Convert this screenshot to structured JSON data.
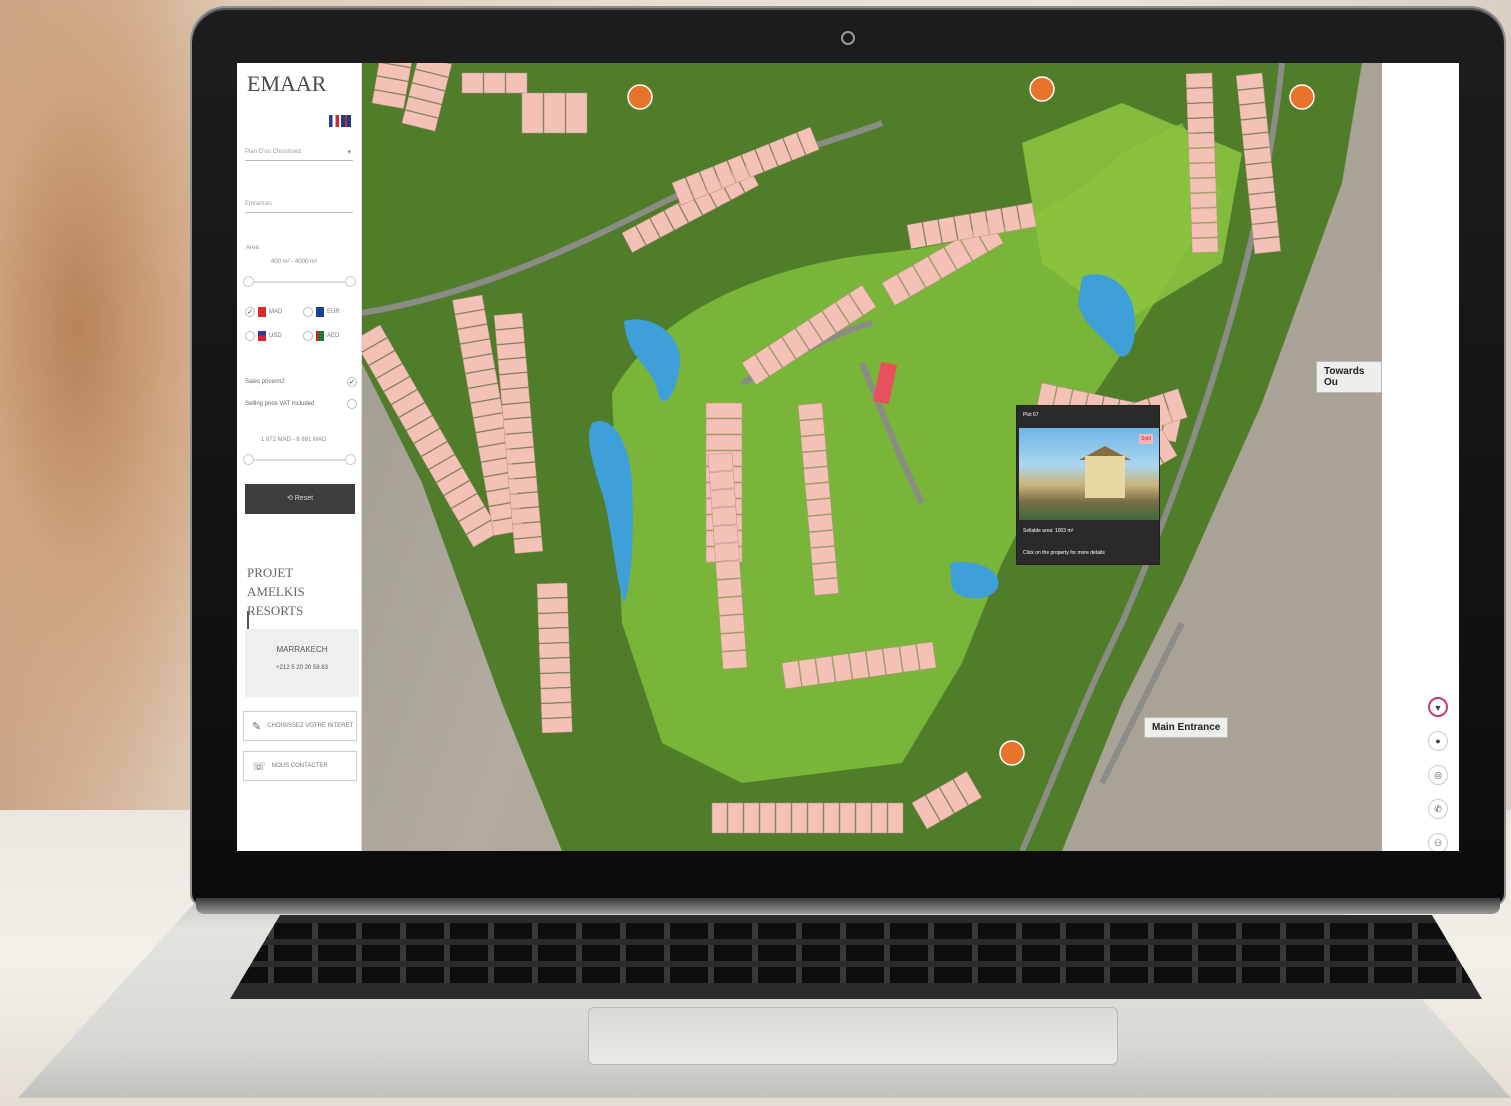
{
  "brand": {
    "logo": "EMAAR"
  },
  "filters": {
    "project_placeholder": "Plan D'ou Choisissez",
    "entrance_label": "Entrances",
    "area_label": "Area",
    "area_range": "400 m² - 4000 m²",
    "currencies": [
      {
        "code": "MAD",
        "checked": true,
        "color": "#d62b2b"
      },
      {
        "code": "EUR",
        "checked": false,
        "color": "#1b3d9c"
      },
      {
        "code": "USD",
        "checked": false,
        "color": "#2a3f8e"
      },
      {
        "code": "AED",
        "checked": false,
        "color": "#1f7a3a"
      }
    ],
    "sales_price_label": "Sales price/m2",
    "sales_price_checked": true,
    "vat_label": "Selling price VAT Included",
    "vat_checked": false,
    "price_range": "1 872 MAD - 8 891 MAD",
    "reset_label": "⟲ Reset"
  },
  "project": {
    "line1": "PROJET",
    "line2": "AMELKIS RESORTS",
    "city": "MARRAKECH",
    "phone": "+212 5 20 20 59 83"
  },
  "actions": [
    {
      "label": "CHOISISSEZ VOTRE INTERET",
      "icon": "✎"
    },
    {
      "label": "NOUS CONTACTER",
      "icon": "☏"
    }
  ],
  "map": {
    "labels": {
      "towards": "Towards Ou",
      "main_entrance": "Main Entrance"
    },
    "tooltip": {
      "title": "Plot 67",
      "sold_badge": "Sold",
      "area_text": "Sellable area: 1003 m²",
      "click_text": "Click on the property for more details"
    },
    "colors": {
      "plot": "#f3c1b6",
      "plot_selected": "#e8505b",
      "green": "#7dbb3a",
      "water": "#3f9fd8"
    }
  },
  "rightbar": {
    "buttons": [
      {
        "icon": "▼",
        "active": true
      },
      {
        "icon": "●",
        "active": false
      },
      {
        "icon": "◎",
        "active": false
      },
      {
        "icon": "✆",
        "active": false
      },
      {
        "icon": "⚇",
        "active": false
      }
    ]
  }
}
